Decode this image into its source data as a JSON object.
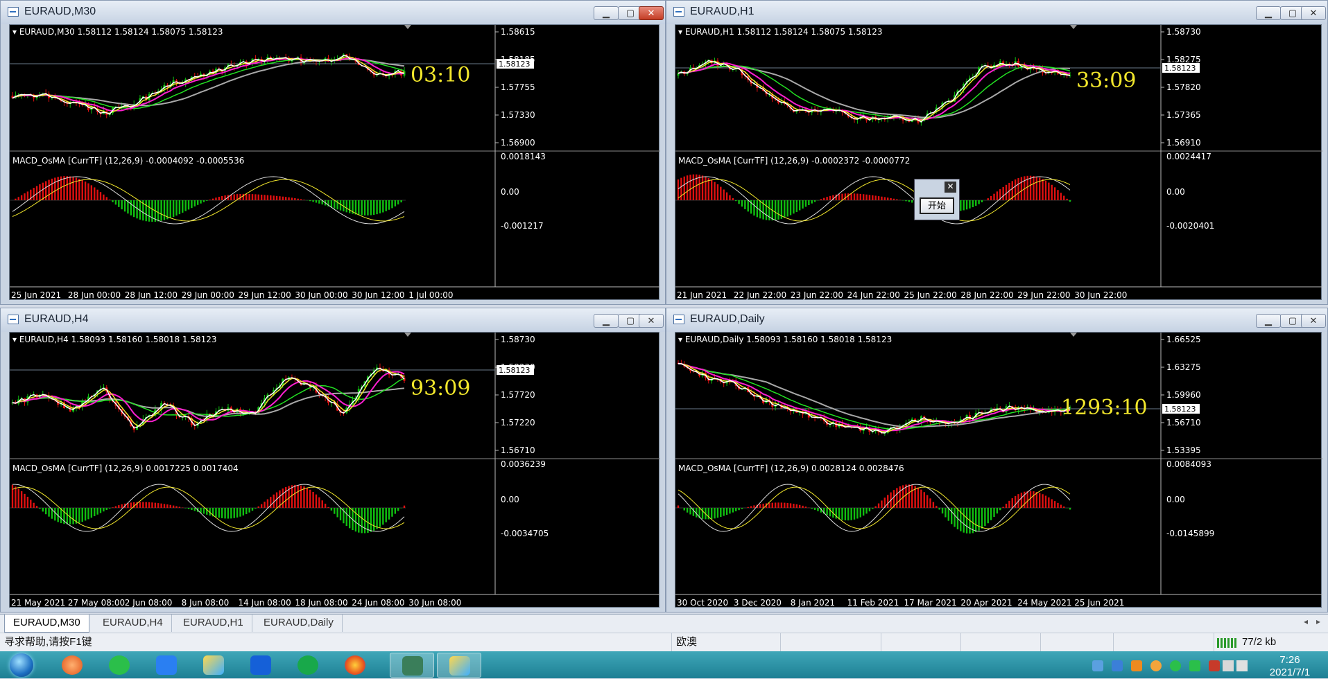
{
  "windows": [
    {
      "id": "m30",
      "title": "EURAUD,M30",
      "header": "EURAUD,M30  1.58112 1.58124 1.58075 1.58123",
      "price_axis": [
        "1.58615",
        "1.58185",
        "1.57755",
        "1.57330",
        "1.56900"
      ],
      "current_price": "1.58123",
      "timer": "03:10",
      "macd_header": "MACD_OsMA [CurrTF] (12,26,9) -0.0004092 -0.0005536",
      "macd_axis": [
        "0.0018143",
        "0.00",
        "-0.001217"
      ],
      "dates": [
        "25 Jun 2021",
        "28 Jun 00:00",
        "28 Jun 12:00",
        "29 Jun 00:00",
        "29 Jun 12:00",
        "30 Jun 00:00",
        "30 Jun 12:00",
        "1 Jul 00:00"
      ]
    },
    {
      "id": "h1",
      "title": "EURAUD,H1",
      "header": "EURAUD,H1  1.58112 1.58124 1.58075 1.58123",
      "price_axis": [
        "1.58730",
        "1.58275",
        "1.57820",
        "1.57365",
        "1.56910"
      ],
      "current_price": "1.58123",
      "timer": "33:09",
      "macd_header": "MACD_OsMA [CurrTF] (12,26,9) -0.0002372 -0.0000772",
      "macd_axis": [
        "0.0024417",
        "0.00",
        "-0.0020401"
      ],
      "dates": [
        "21 Jun 2021",
        "22 Jun 22:00",
        "23 Jun 22:00",
        "24 Jun 22:00",
        "25 Jun 22:00",
        "28 Jun 22:00",
        "29 Jun 22:00",
        "30 Jun 22:00"
      ]
    },
    {
      "id": "h4",
      "title": "EURAUD,H4",
      "header": "EURAUD,H4  1.58093 1.58160 1.58018 1.58123",
      "price_axis": [
        "1.58730",
        "1.58230",
        "1.57720",
        "1.57220",
        "1.56710"
      ],
      "current_price": "1.58123",
      "timer": "93:09",
      "macd_header": "MACD_OsMA [CurrTF] (12,26,9) 0.0017225 0.0017404",
      "macd_axis": [
        "0.0036239",
        "0.00",
        "-0.0034705"
      ],
      "dates": [
        "21 May 2021",
        "27 May 08:00",
        "2 Jun 08:00",
        "8 Jun 08:00",
        "14 Jun 08:00",
        "18 Jun 08:00",
        "24 Jun 08:00",
        "30 Jun 08:00"
      ]
    },
    {
      "id": "d1",
      "title": "EURAUD,Daily",
      "header": "EURAUD,Daily  1.58093 1.58160 1.58018 1.58123",
      "price_axis": [
        "1.66525",
        "1.63275",
        "1.59960",
        "1.56710",
        "1.53395"
      ],
      "current_price": "1.58123",
      "timer": "1293:10",
      "macd_header": "MACD_OsMA [CurrTF] (12,26,9) 0.0028124 0.0028476",
      "macd_axis": [
        "0.0084093",
        "0.00",
        "-0.0145899"
      ],
      "dates": [
        "30 Oct 2020",
        "3 Dec 2020",
        "8 Jan 2021",
        "11 Feb 2021",
        "17 Mar 2021",
        "20 Apr 2021",
        "24 May 2021",
        "25 Jun 2021"
      ]
    }
  ],
  "window_buttons": {
    "minimize": "▁",
    "maximize": "▢",
    "close": "✕"
  },
  "dialog": {
    "close": "✕",
    "button": "开始"
  },
  "tabs": [
    "EURAUD,M30",
    "EURAUD,H4",
    "EURAUD,H1",
    "EURAUD,Daily"
  ],
  "tab_nav": {
    "left": "◂",
    "right": "▸"
  },
  "status": {
    "help": "寻求帮助,请按F1键",
    "profile": "欧澳",
    "traffic": "77/2 kb"
  },
  "clock": {
    "time": "7:26",
    "date": "2021/7/1"
  },
  "colors": {
    "candle_up": "#10c010",
    "candle_down": "#e01010",
    "ma_fast": "#ffffff",
    "ma_yellow": "#f2e72c",
    "ma_magenta": "#ff1fd0",
    "ma_green": "#22e022",
    "ma_gray": "#a8a8a8",
    "timer": "#f2e72c"
  }
}
